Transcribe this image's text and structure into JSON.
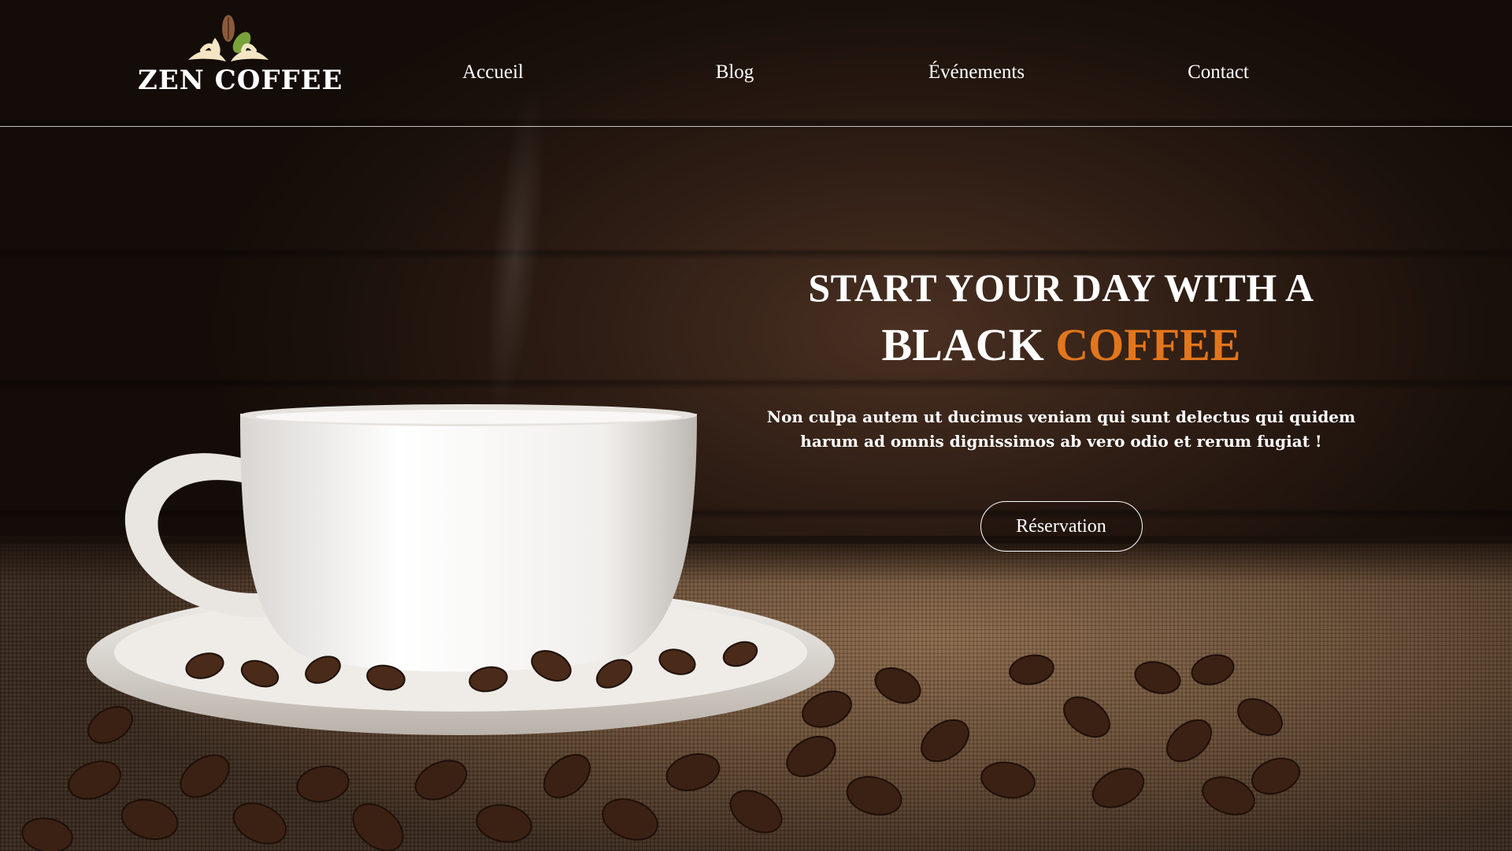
{
  "brand": {
    "name": "ZEN COFFEE",
    "icon": "coffee-leaves-logo-icon"
  },
  "nav": {
    "items": [
      {
        "label": "Accueil"
      },
      {
        "label": "Blog"
      },
      {
        "label": "Événements"
      },
      {
        "label": "Contact"
      }
    ]
  },
  "hero": {
    "headline_line1": "START YOUR DAY WITH A",
    "headline_black": "BLACK",
    "headline_coffee": "COFFEE",
    "description": "Non culpa autem ut ducimus veniam qui sunt delectus qui quidem harum ad omnis dignissimos ab vero odio et rerum fugiat !",
    "cta_label": "Réservation"
  },
  "colors": {
    "accent": "#e2761c",
    "text": "#ffffff",
    "background": "#1b110b"
  }
}
